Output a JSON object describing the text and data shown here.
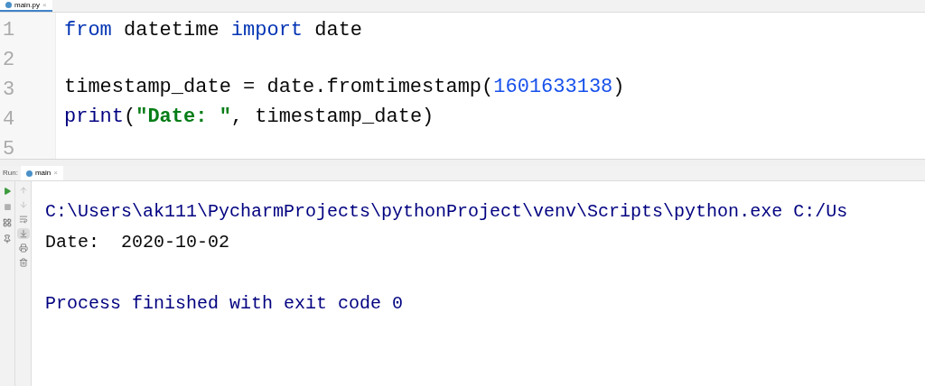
{
  "editor_tabs": [
    {
      "label": "main.py",
      "close": "×",
      "selected": true
    }
  ],
  "editor": {
    "lines": [
      {
        "number": "1",
        "tokens": [
          {
            "kind": "keyword",
            "text": "from"
          },
          {
            "kind": "plain",
            "text": " datetime "
          },
          {
            "kind": "keyword",
            "text": "import"
          },
          {
            "kind": "plain",
            "text": " date"
          }
        ]
      },
      {
        "number": "2"
      },
      {
        "number": "3",
        "tokens": [
          {
            "kind": "plain",
            "text": "timestamp_date = date.fromtimestamp("
          },
          {
            "kind": "number",
            "text": "1601633138"
          },
          {
            "kind": "plain",
            "text": ")"
          }
        ]
      },
      {
        "number": "4",
        "tokens": [
          {
            "kind": "builtin",
            "text": "print"
          },
          {
            "kind": "plain",
            "text": "("
          },
          {
            "kind": "string",
            "text": "\"Date: \""
          },
          {
            "kind": "plain",
            "text": ", timestamp_date)"
          }
        ]
      },
      {
        "number": "5"
      }
    ]
  },
  "run_panel": {
    "label": "Run:",
    "tab": {
      "label": "main",
      "close": "×",
      "selected": true
    },
    "left_tools": [
      {
        "kind": "run",
        "disabled": false
      },
      {
        "kind": "stop",
        "disabled": true
      },
      {
        "kind": "layout",
        "disabled": false
      },
      {
        "kind": "pin",
        "disabled": false
      }
    ],
    "output_tools": [
      {
        "kind": "up",
        "selected": false
      },
      {
        "kind": "down",
        "selected": false
      },
      {
        "kind": "wrap",
        "selected": false
      },
      {
        "kind": "scroll-end",
        "selected": true
      },
      {
        "kind": "print",
        "selected": false
      },
      {
        "kind": "trash",
        "selected": false
      }
    ],
    "output": [
      {
        "kind": "system",
        "text": "C:\\Users\\ak111\\PycharmProjects\\pythonProject\\venv\\Scripts\\python.exe C:/Us"
      },
      {
        "kind": "stdout",
        "text": "Date:  2020-10-02"
      },
      {
        "kind": "blank"
      },
      {
        "kind": "system",
        "text": "Process finished with exit code 0"
      }
    ]
  }
}
